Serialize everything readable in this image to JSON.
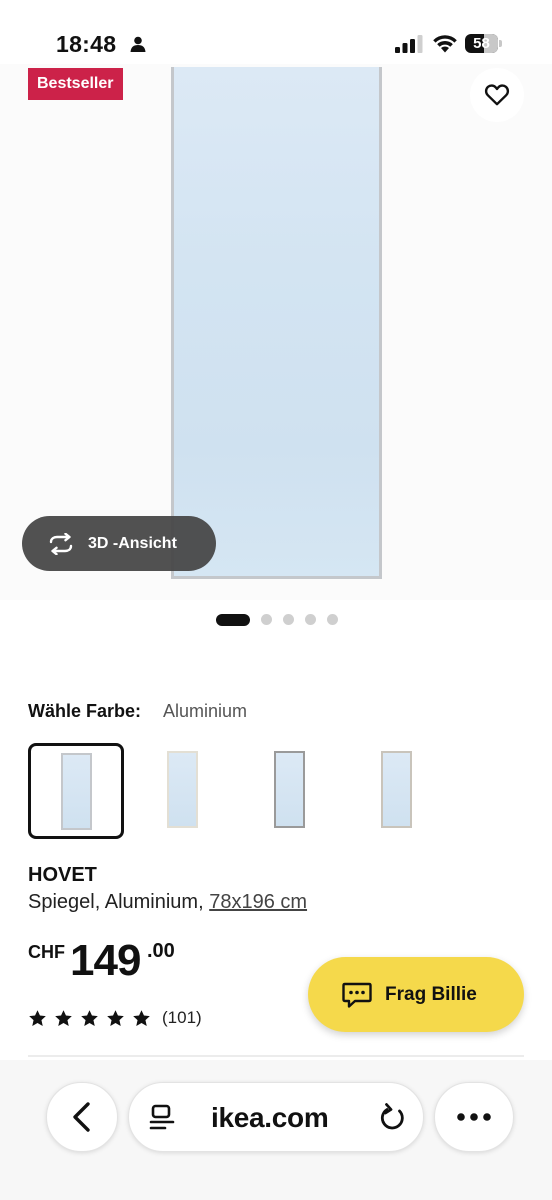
{
  "status_bar": {
    "time": "18:48",
    "battery_level": "58"
  },
  "product_image": {
    "badge": "Bestseller",
    "view_3d_label": "3D -Ansicht",
    "total_images": 5,
    "active_image_index": 0
  },
  "color_picker": {
    "label": "Wähle Farbe:",
    "selected_value": "Aluminium",
    "swatch_count": 4,
    "selected_index": 0,
    "frame_colors": [
      "#c4c7cb",
      "#e3dfd4",
      "#9a9a9a",
      "#c9c4bb"
    ]
  },
  "product": {
    "name": "HOVET",
    "description": "Spiegel, Aluminium, ",
    "size_link": "78x196 cm",
    "price": {
      "currency": "CHF",
      "integer": "149",
      "decimal": ".00"
    },
    "rating_stars": 5,
    "review_count": "(101)"
  },
  "chat": {
    "label": "Frag Billie"
  },
  "browser": {
    "domain": "ikea.com"
  },
  "colors": {
    "badge": "#cc2249",
    "chat_button": "#f5d94b"
  }
}
